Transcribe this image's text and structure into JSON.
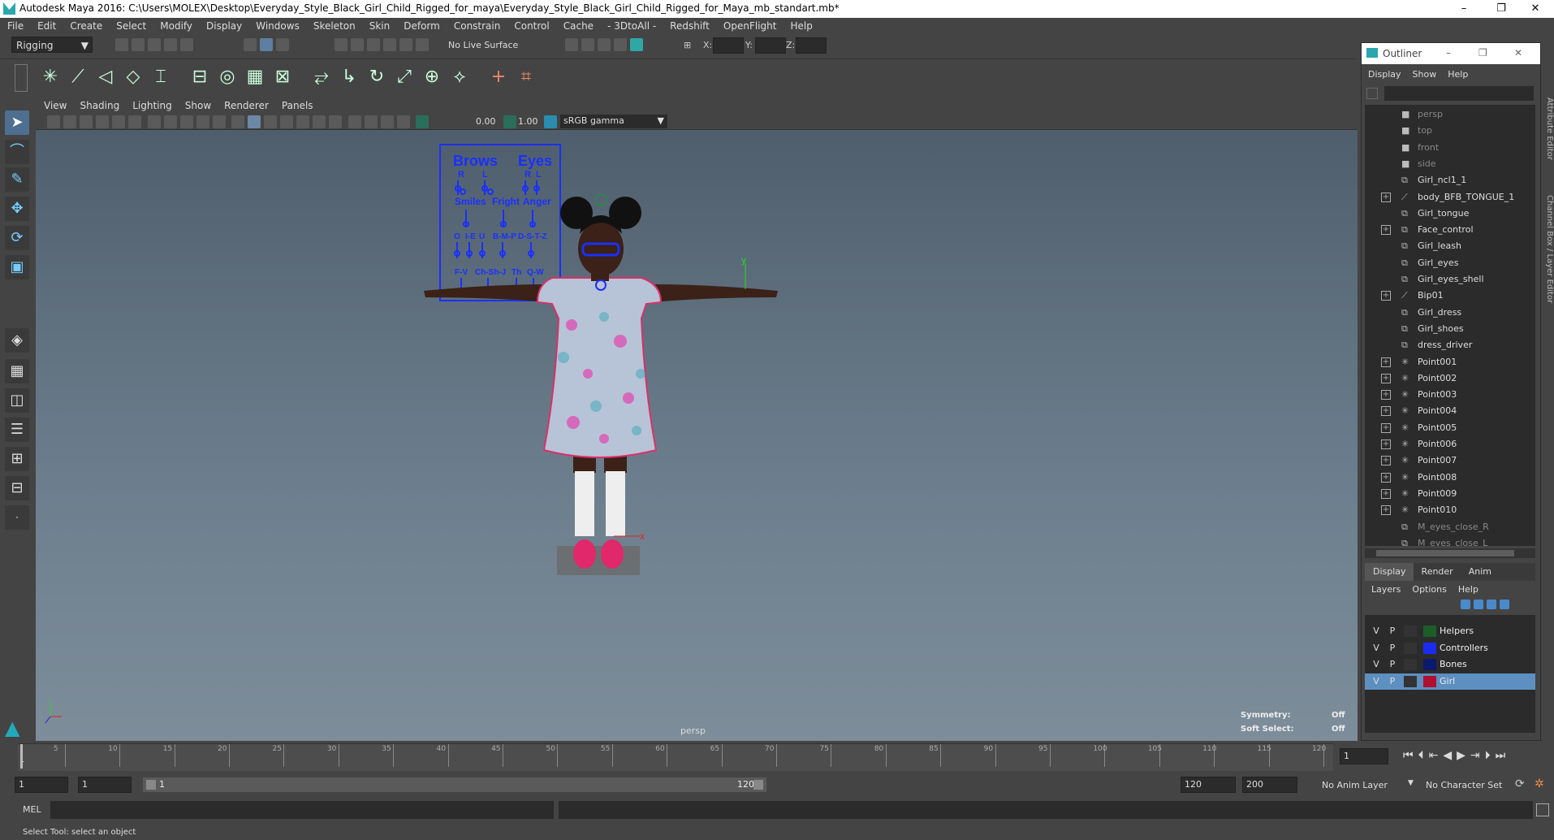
{
  "window": {
    "title": "Autodesk Maya 2016: C:\\Users\\MOLEX\\Desktop\\Everyday_Style_Black_Girl_Child_Rigged_for_maya\\Everyday_Style_Black_Girl_Child_Rigged_for_Maya_mb_standart.mb*",
    "minimize": "–",
    "restore": "❐",
    "close": "✕"
  },
  "menu": [
    "File",
    "Edit",
    "Create",
    "Select",
    "Modify",
    "Display",
    "Windows",
    "Skeleton",
    "Skin",
    "Deform",
    "Constrain",
    "Control",
    "Cache",
    "- 3DtoAll -",
    "Redshift",
    "OpenFlight",
    "Help"
  ],
  "status": {
    "mode": "Rigging",
    "live_surface": "No Live Surface",
    "x_label": "X:",
    "y_label": "Y:",
    "z_label": "Z:"
  },
  "viewport": {
    "menu": [
      "View",
      "Shading",
      "Lighting",
      "Show",
      "Renderer",
      "Panels"
    ],
    "near": "0.00",
    "far": "1.00",
    "gamma": "sRGB gamma",
    "camera_label": "persp",
    "symmetry_label": "Symmetry:",
    "symmetry_value": "Off",
    "softselect_label": "Soft Select:",
    "softselect_value": "Off",
    "face_panel": {
      "brows": "Brows",
      "eyes": "Eyes",
      "r1": "R",
      "l1": "L",
      "r2": "R",
      "l2": "L",
      "smiles": "Smiles",
      "fright": "Fright",
      "anger": "Anger",
      "p1": "O",
      "p2": "I-E",
      "p3": "U",
      "p4": "B-M-P",
      "p5": "D-S-T-Z",
      "p6": "F-V",
      "p7": "Ch-Sh-J",
      "p8": "Th",
      "p9": "Q-W",
      "y_axis": "y"
    },
    "axis_y": "y",
    "axis_x": "x"
  },
  "outliner": {
    "title": "Outliner",
    "menu": [
      "Display",
      "Show",
      "Help"
    ],
    "items": [
      {
        "label": "persp",
        "dim": true,
        "icon": "camera-icon",
        "expand": false
      },
      {
        "label": "top",
        "dim": true,
        "icon": "camera-icon",
        "expand": false
      },
      {
        "label": "front",
        "dim": true,
        "icon": "camera-icon",
        "expand": false
      },
      {
        "label": "side",
        "dim": true,
        "icon": "camera-icon",
        "expand": false
      },
      {
        "label": "Girl_ncl1_1",
        "dim": false,
        "icon": "mesh-icon",
        "expand": false
      },
      {
        "label": "body_BFB_TONGUE_1",
        "dim": false,
        "icon": "joint-icon",
        "expand": true
      },
      {
        "label": "Girl_tongue",
        "dim": false,
        "icon": "mesh-icon",
        "expand": false
      },
      {
        "label": "Face_control",
        "dim": false,
        "icon": "mesh-icon",
        "expand": true
      },
      {
        "label": "Girl_leash",
        "dim": false,
        "icon": "mesh-icon",
        "expand": false
      },
      {
        "label": "Girl_eyes",
        "dim": false,
        "icon": "mesh-icon",
        "expand": false
      },
      {
        "label": "Girl_eyes_shell",
        "dim": false,
        "icon": "mesh-icon",
        "expand": false
      },
      {
        "label": "Bip01",
        "dim": false,
        "icon": "joint-icon",
        "expand": true
      },
      {
        "label": "Girl_dress",
        "dim": false,
        "icon": "mesh-icon",
        "expand": false
      },
      {
        "label": "Girl_shoes",
        "dim": false,
        "icon": "mesh-icon",
        "expand": false
      },
      {
        "label": "dress_driver",
        "dim": false,
        "icon": "mesh-icon",
        "expand": false
      },
      {
        "label": "Point001",
        "dim": false,
        "icon": "locator-icon",
        "expand": true
      },
      {
        "label": "Point002",
        "dim": false,
        "icon": "locator-icon",
        "expand": true
      },
      {
        "label": "Point003",
        "dim": false,
        "icon": "locator-icon",
        "expand": true
      },
      {
        "label": "Point004",
        "dim": false,
        "icon": "locator-icon",
        "expand": true
      },
      {
        "label": "Point005",
        "dim": false,
        "icon": "locator-icon",
        "expand": true
      },
      {
        "label": "Point006",
        "dim": false,
        "icon": "locator-icon",
        "expand": true
      },
      {
        "label": "Point007",
        "dim": false,
        "icon": "locator-icon",
        "expand": true
      },
      {
        "label": "Point008",
        "dim": false,
        "icon": "locator-icon",
        "expand": true
      },
      {
        "label": "Point009",
        "dim": false,
        "icon": "locator-icon",
        "expand": true
      },
      {
        "label": "Point010",
        "dim": false,
        "icon": "locator-icon",
        "expand": true
      },
      {
        "label": "M_eyes_close_R",
        "dim": true,
        "icon": "mesh-icon",
        "expand": false
      },
      {
        "label": "M_eyes_close_L",
        "dim": true,
        "icon": "mesh-icon",
        "expand": false
      }
    ],
    "tabs": [
      "Display",
      "Render",
      "Anim"
    ],
    "layer_menu": [
      "Layers",
      "Options",
      "Help"
    ],
    "layers": [
      {
        "v": "V",
        "p": "P",
        "name": "Helpers",
        "color": "#1b5e2a",
        "selected": false
      },
      {
        "v": "V",
        "p": "P",
        "name": "Controllers",
        "color": "#1a2cf0",
        "selected": false
      },
      {
        "v": "V",
        "p": "P",
        "name": "Bones",
        "color": "#0b1a6b",
        "selected": false
      },
      {
        "v": "V",
        "p": "P",
        "name": "Girl",
        "color": "#b01030",
        "selected": true
      }
    ],
    "side_tab_1": "Attribute Editor",
    "side_tab_2": "Channel Box / Layer Editor"
  },
  "timeline": {
    "ticks": [
      "5",
      "10",
      "15",
      "20",
      "25",
      "30",
      "35",
      "40",
      "45",
      "50",
      "55",
      "60",
      "65",
      "70",
      "75",
      "80",
      "85",
      "90",
      "95",
      "100",
      "105",
      "110",
      "115",
      "120"
    ],
    "start_tick": "1",
    "current_frame": "1"
  },
  "range": {
    "start": "1",
    "anim_start": "1",
    "slider_start": "1",
    "slider_end": "120",
    "end": "120",
    "anim_end": "200",
    "anim_layer": "No Anim Layer",
    "char_set": "No Character Set"
  },
  "cmd": {
    "label": "MEL"
  },
  "help": "Select Tool: select an object"
}
